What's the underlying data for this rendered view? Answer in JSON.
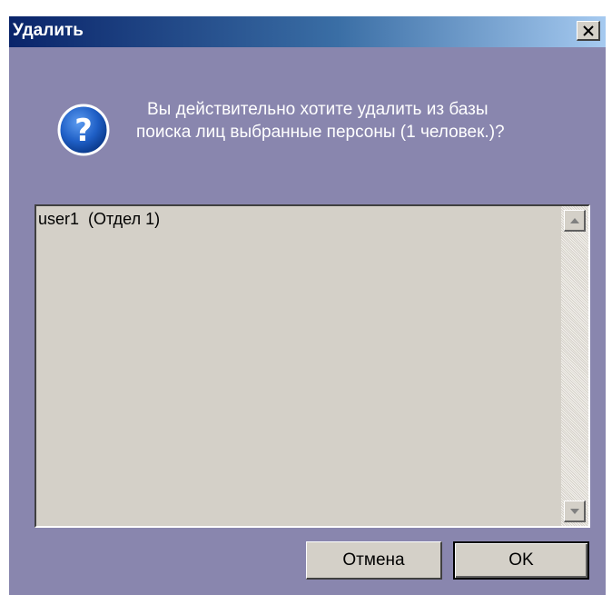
{
  "window": {
    "title": "Удалить",
    "close_icon": "close-icon"
  },
  "message": {
    "icon": "question-icon",
    "line1": "Вы действительно хотите удалить из базы",
    "line2": "поиска лиц выбранные персоны (1 человек.)?"
  },
  "list": {
    "items": [
      "user1  (Отдел 1)"
    ]
  },
  "buttons": {
    "cancel_label": "Отмена",
    "ok_label": "OK"
  },
  "colors": {
    "dialog_background": "#8986ae",
    "title_gradient_start": "#0a246a",
    "title_gradient_end": "#a6caf0",
    "control_face": "#d4d0c8",
    "icon_blue": "#1f5fc6"
  }
}
